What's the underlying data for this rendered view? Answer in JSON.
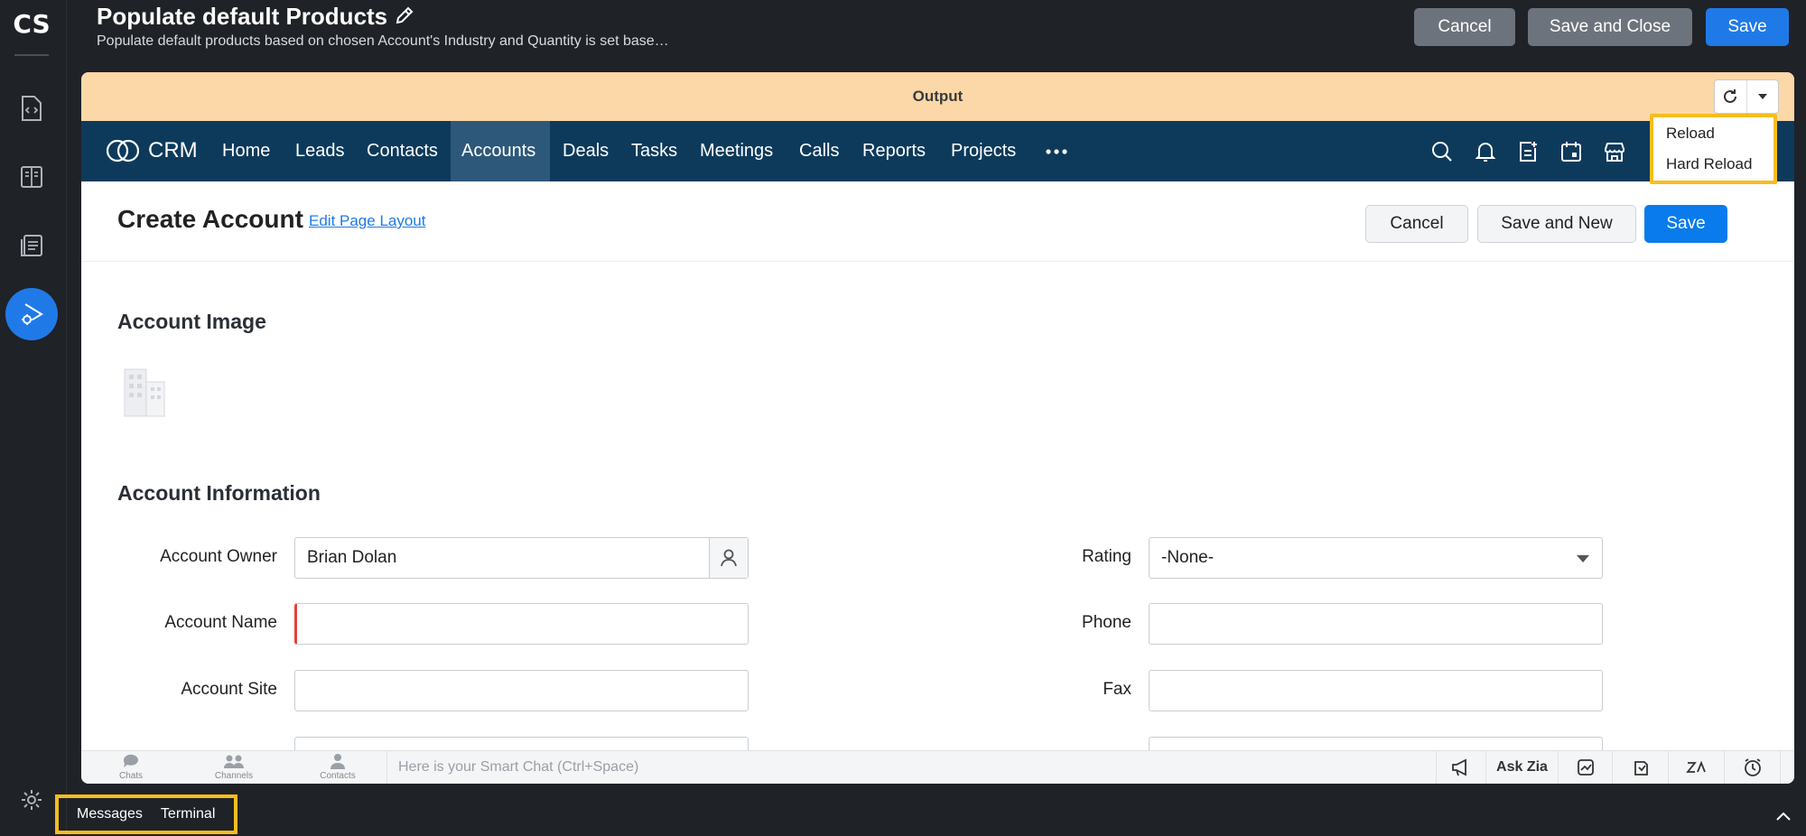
{
  "rail": {
    "logo": "CS",
    "icons": [
      "code-file-icon",
      "book-icon",
      "documents-icon",
      "debug-run-icon",
      "settings-icon"
    ]
  },
  "header": {
    "title": "Populate default Products",
    "subtitle": "Populate default products based on chosen Account's Industry and Quantity is set base…",
    "cancel_label": "Cancel",
    "save_close_label": "Save and Close",
    "save_label": "Save"
  },
  "output": {
    "title": "Output",
    "menu": [
      "Reload",
      "Hard Reload"
    ]
  },
  "crm": {
    "brand": "CRM",
    "nav": [
      "Home",
      "Leads",
      "Contacts",
      "Accounts",
      "Deals",
      "Tasks",
      "Meetings",
      "Calls",
      "Reports",
      "Projects"
    ],
    "active_tab": "Accounts"
  },
  "page": {
    "title": "Create Account",
    "edit_layout": "Edit Page Layout",
    "cancel_label": "Cancel",
    "save_new_label": "Save and New",
    "save_label": "Save",
    "section_image": "Account Image",
    "section_info": "Account Information",
    "fields": {
      "owner_label": "Account Owner",
      "owner_value": "Brian Dolan",
      "name_label": "Account Name",
      "site_label": "Account Site",
      "rating_label": "Rating",
      "rating_value": "-None-",
      "phone_label": "Phone",
      "fax_label": "Fax"
    }
  },
  "chatbar": {
    "items": [
      "Chats",
      "Channels",
      "Contacts"
    ],
    "placeholder": "Here is your Smart Chat (Ctrl+Space)",
    "ask_zia": "Ask Zia"
  },
  "bottom": {
    "tabs": [
      "Messages",
      "Terminal"
    ]
  }
}
